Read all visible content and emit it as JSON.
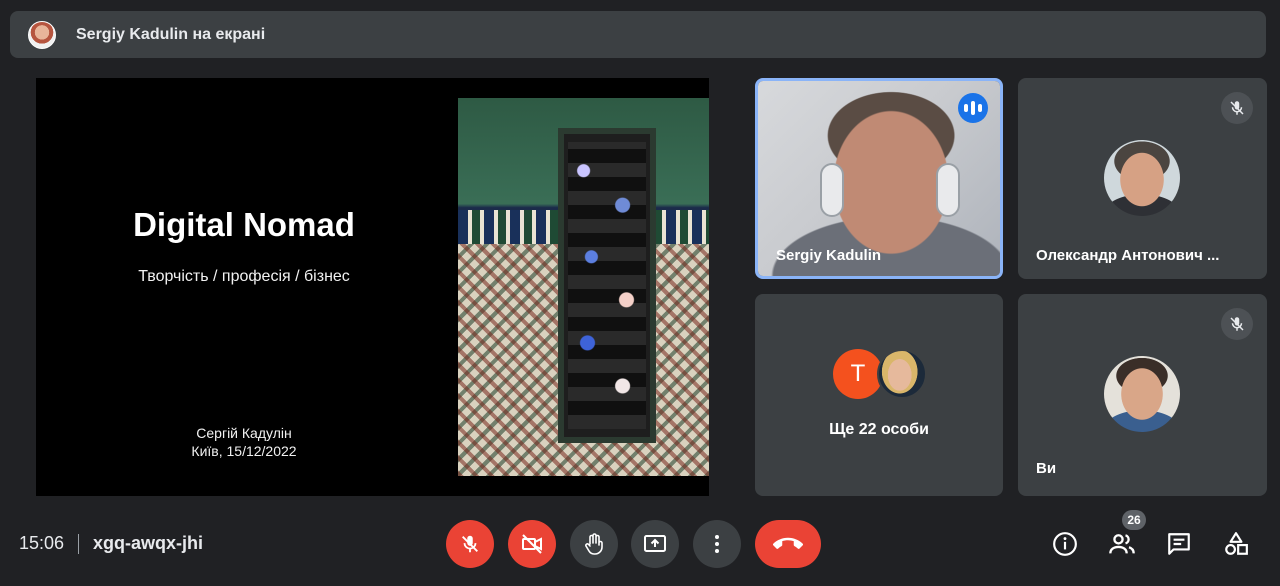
{
  "banner": {
    "text": "Sergiy Kadulin на екрані"
  },
  "slide": {
    "title": "Digital Nomad",
    "subtitle": "Творчість / професія / бізнес",
    "author": "Сергій Кадулін",
    "place_date": "Київ, 15/12/2022"
  },
  "tiles": {
    "presenter": {
      "name": "Sergiy Kadulin",
      "status": "speaking"
    },
    "participant1": {
      "name": "Олександр Антонович ...",
      "status": "muted"
    },
    "others": {
      "letter_avatar": "T",
      "label": "Ще 22 особи"
    },
    "self": {
      "name": "Ви",
      "status": "muted"
    }
  },
  "meeting": {
    "time": "15:06",
    "code": "xgq-awqx-jhi",
    "participants_count": "26"
  },
  "icons": {
    "mic": "mic-off-icon",
    "camera": "videocam-off-icon",
    "hand": "raise-hand-icon",
    "present": "present-screen-icon",
    "more": "more-vert-icon",
    "hangup": "call-end-icon",
    "info": "info-icon",
    "people": "people-icon",
    "chat": "chat-icon",
    "activities": "activities-icon"
  },
  "colors": {
    "background": "#202124",
    "tile": "#3c4043",
    "danger": "#ea4335",
    "accent": "#8ab4f8",
    "speaking": "#1a73e8",
    "letter_avatar": "#f4511e"
  }
}
